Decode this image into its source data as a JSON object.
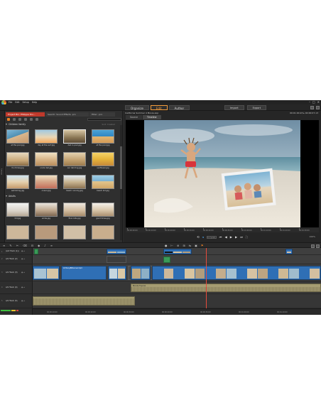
{
  "menubar": {
    "items": [
      "File",
      "Edit",
      "Setup",
      "Help"
    ],
    "window_controls": [
      "–",
      "□",
      "✕"
    ]
  },
  "modebar": {
    "tabs": [
      "Organize",
      "Edit",
      "Author"
    ],
    "active_tab": "Edit",
    "import_label": "Import",
    "export_label": "Export"
  },
  "library": {
    "tabs": [
      "Project Bin: Philippe thu...",
      "Search: Sound Effects .pro",
      "Filter: .pro"
    ],
    "search_placeholder": "",
    "sidebar_label": "Library",
    "sections": [
      {
        "title": "Children family",
        "sort": "Sort: Created"
      },
      {
        "title": "Adults",
        "sort": ""
      }
    ],
    "row1": [
      "at the pool.jpg",
      "day at the surf.jpg",
      "dad in pool.jpg",
      "at the pool.jpg"
    ],
    "row2": [
      "fun times.jpg",
      "uncle dad.jpg",
      "our dad dog.jpg",
      "sunflower.jpg"
    ],
    "row3": [
      "swimming.jpg",
      "ocean.jpg",
      "beach running.jpg",
      "beach kid.jpg"
    ],
    "row4": [
      "hill.jpg",
      "smile.jpg",
      "floor kids.jpg",
      "good times.jpg"
    ]
  },
  "player": {
    "title": "California Summer 4 Movie.axp",
    "timecode": "00:01:00.23  ▸ 00:00:07.13",
    "tabs": [
      "Source",
      "Timeline"
    ],
    "active_tab": "Timeline",
    "ruler": [
      "00:00:00:00",
      "00:00:10:00",
      "00:00:20:00",
      "00:00:30:00",
      "00:00:40:00",
      "00:00:50:00",
      "00:01:00:00",
      "00:01:10:00",
      "00:01:20:00",
      "00:01:30:00"
    ],
    "zoom": "100%",
    "ctrl_box": "Complete"
  },
  "timeline": {
    "tracks": [
      {
        "num": "1",
        "name": "(A/V Track (1))"
      },
      {
        "num": "2",
        "name": "A/V Track (2)"
      },
      {
        "num": "3",
        "name": "A/V Track (3)"
      },
      {
        "num": "4",
        "name": "A/V Track (4)"
      },
      {
        "num": "5",
        "name": "A/V Track (5)"
      }
    ],
    "clip_labels": {
      "main_video": "At ManyBtRunnel.mp4",
      "audio_main": "Blonde Tropical"
    },
    "ruler": [
      "00:00:10:00",
      "00:00:20:00",
      "00:00:30:00",
      "00:00:40:00",
      "00:00:50:00",
      "00:01:00:00",
      "00:01:10:00"
    ]
  },
  "colors": {
    "accent": "#f39c3c",
    "clip_video": "#2f6fb5",
    "clip_audio": "#a59c72",
    "playhead": "#e74c3c"
  }
}
